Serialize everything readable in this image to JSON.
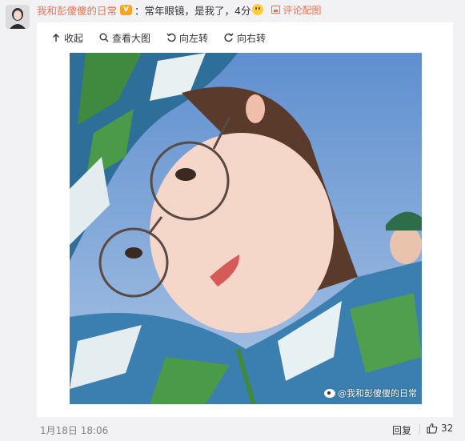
{
  "comment": {
    "username": "我和彭傻傻的日常",
    "vip_badge": "V",
    "text": "：常年眼镜，是我了，4分",
    "emoji_icon": "blush-face-icon",
    "reply_pic_label": "评论配图"
  },
  "toolbar": {
    "collapse_label": "收起",
    "view_large_label": "查看大图",
    "rotate_left_label": "向左转",
    "rotate_right_label": "向右转"
  },
  "photo": {
    "watermark_text": "@我和彭傻傻的日常"
  },
  "footer": {
    "timestamp": "1月18日 18:06",
    "reply_label": "回复",
    "like_count": "32"
  },
  "colors": {
    "accent": "#eb7350",
    "background": "#f2f2f5",
    "card": "#ffffff"
  }
}
